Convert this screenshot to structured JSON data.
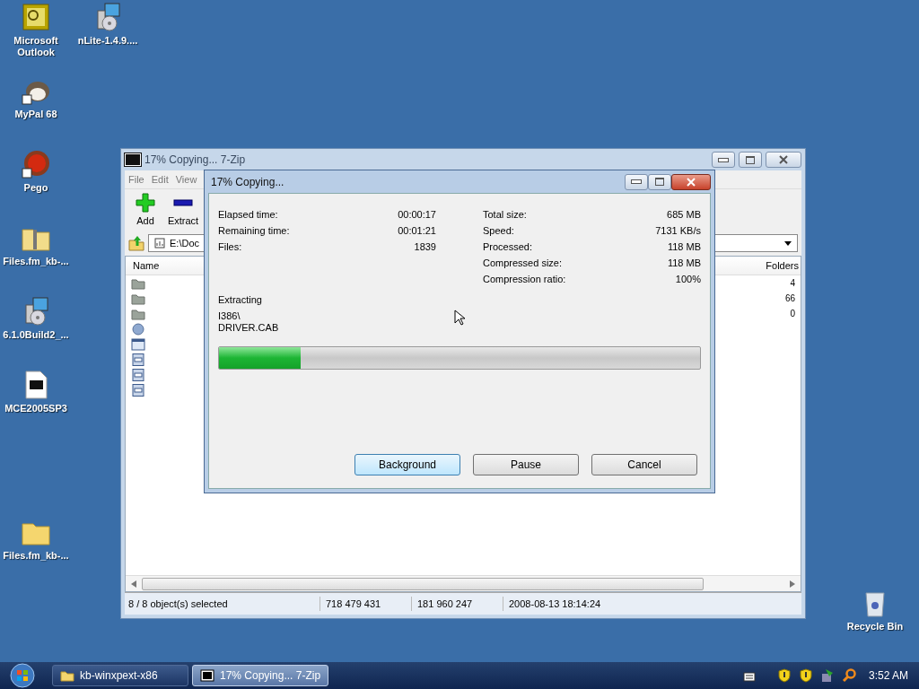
{
  "desktop_icons": [
    {
      "label": "Microsoft Outlook",
      "kind": "outlook"
    },
    {
      "label": "nLite-1.4.9....",
      "kind": "installer"
    },
    {
      "label": "MyPal 68",
      "kind": "animal"
    },
    {
      "label": "Pego",
      "kind": "ball"
    },
    {
      "label": "Files.fm_kb-...",
      "kind": "zipfolder"
    },
    {
      "label": "6.1.0Build2_...",
      "kind": "installer"
    },
    {
      "label": "MCE2005SP3",
      "kind": "archive"
    },
    {
      "label": "Files.fm_kb-...",
      "kind": "folder"
    },
    {
      "label": "Recycle Bin",
      "kind": "bin"
    }
  ],
  "main_window": {
    "title": "17% Copying... 7-Zip",
    "menu": [
      "File",
      "Edit",
      "View"
    ],
    "toolbar": [
      {
        "label": "Add",
        "kind": "add"
      },
      {
        "label": "Extract",
        "kind": "extract"
      }
    ],
    "address": "E:\\Doc",
    "columns": [
      "Name",
      "Folders"
    ],
    "rows": [
      {
        "kind": "folder",
        "folders": "4"
      },
      {
        "kind": "folder",
        "folders": "66"
      },
      {
        "kind": "folder",
        "folders": "0"
      },
      {
        "kind": "disc"
      },
      {
        "kind": "window"
      },
      {
        "kind": "doc"
      },
      {
        "kind": "doc"
      },
      {
        "kind": "doc"
      }
    ],
    "status_bar": [
      "8 / 8 object(s) selected",
      "718 479 431",
      "181 960 247",
      "2008-08-13 18:14:24"
    ]
  },
  "dialog": {
    "title": "17% Copying...",
    "stats_left": [
      {
        "label": "Elapsed time:",
        "value": "00:00:17"
      },
      {
        "label": "Remaining time:",
        "value": "00:01:21"
      },
      {
        "label": "Files:",
        "value": "1839"
      }
    ],
    "stats_right": [
      {
        "label": "Total size:",
        "value": "685 MB"
      },
      {
        "label": "Speed:",
        "value": "7131 KB/s"
      },
      {
        "label": "Processed:",
        "value": "118 MB"
      },
      {
        "label": "Compressed size:",
        "value": "118 MB"
      },
      {
        "label": "Compression ratio:",
        "value": "100%"
      }
    ],
    "action": "Extracting",
    "path": [
      "I386\\",
      "DRIVER.CAB"
    ],
    "progress": {
      "level": 0.17
    },
    "buttons": [
      {
        "label": "Background",
        "selected": true
      },
      {
        "label": "Pause",
        "selected": false
      },
      {
        "label": "Cancel",
        "selected": false
      }
    ]
  },
  "taskbar": {
    "tasks": [
      {
        "label": "kb-winxpext-x86",
        "kind": "folder",
        "selected": false
      },
      {
        "label": "17% Copying... 7-Zip",
        "kind": "sevenzip",
        "selected": true
      }
    ],
    "clock": "3:52 AM"
  }
}
